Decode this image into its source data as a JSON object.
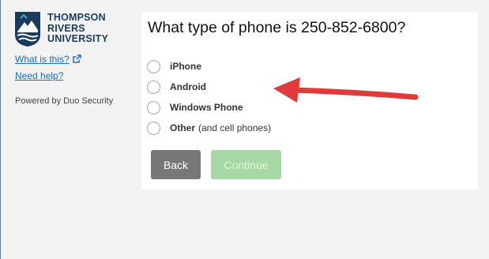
{
  "brand": {
    "logo_lines": [
      "THOMPSON",
      "RIVERS",
      "UNIVERSITY"
    ]
  },
  "sidebar": {
    "what_is_this": "What is this?",
    "need_help": "Need help?",
    "powered_by": "Powered by Duo Security"
  },
  "main": {
    "question": "What type of phone is 250-852-6800?",
    "options": [
      {
        "label": "iPhone",
        "sub": ""
      },
      {
        "label": "Android",
        "sub": ""
      },
      {
        "label": "Windows Phone",
        "sub": ""
      },
      {
        "label": "Other",
        "sub": "(and cell phones)"
      }
    ],
    "back_label": "Back",
    "continue_label": "Continue"
  },
  "colors": {
    "brand_navy": "#1b3a5c",
    "link_blue": "#1a6cb5",
    "back_button": "#777777",
    "continue_disabled": "#a6d8a6",
    "annotation_red": "#e03a3a"
  },
  "icons": {
    "logo": "tru-mountain-logo",
    "external_link": "external-link-icon",
    "annotation": "red-arrow-pointing-left"
  }
}
